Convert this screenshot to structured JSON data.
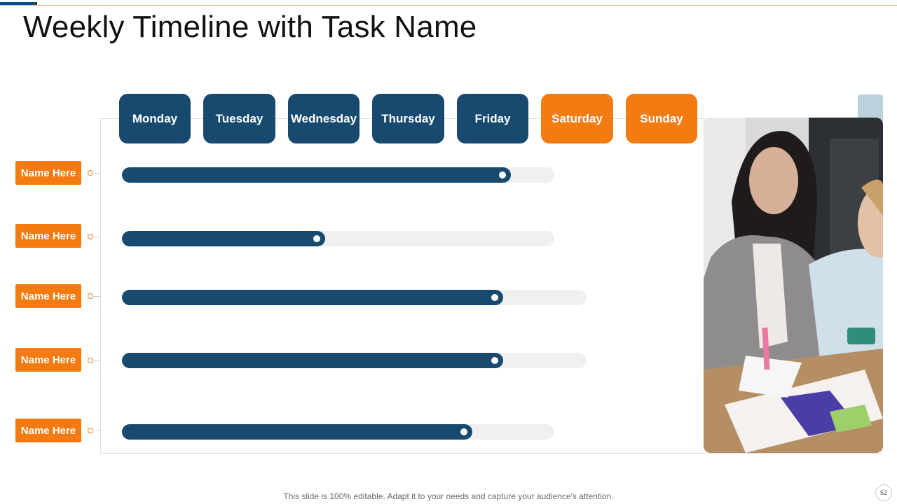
{
  "slide": {
    "title": "Weekly Timeline with Task Name",
    "footer": "This slide is 100% editable. Adapt it to your needs and capture your audience's attention.",
    "page_number": "52"
  },
  "days": [
    {
      "label": "Monday",
      "type": "weekday"
    },
    {
      "label": "Tuesday",
      "type": "weekday"
    },
    {
      "label": "Wednesday",
      "type": "weekday"
    },
    {
      "label": "Thursday",
      "type": "weekday"
    },
    {
      "label": "Friday",
      "type": "weekday"
    },
    {
      "label": "Saturday",
      "type": "weekend"
    },
    {
      "label": "Sunday",
      "type": "weekend"
    }
  ],
  "tasks": [
    {
      "label": "Name Here",
      "progress_pct": 90
    },
    {
      "label": "Name Here",
      "progress_pct": 47
    },
    {
      "label": "Name Here",
      "progress_pct": 82
    },
    {
      "label": "Name Here",
      "progress_pct": 82
    },
    {
      "label": "Name Here",
      "progress_pct": 81
    }
  ],
  "colors": {
    "weekday": "#174a6e",
    "weekend": "#f47b12",
    "bar": "#174a6e",
    "track": "#f0f0f0",
    "tag": "#f47b12"
  },
  "photo": {
    "icon": "team-meeting-photo"
  }
}
